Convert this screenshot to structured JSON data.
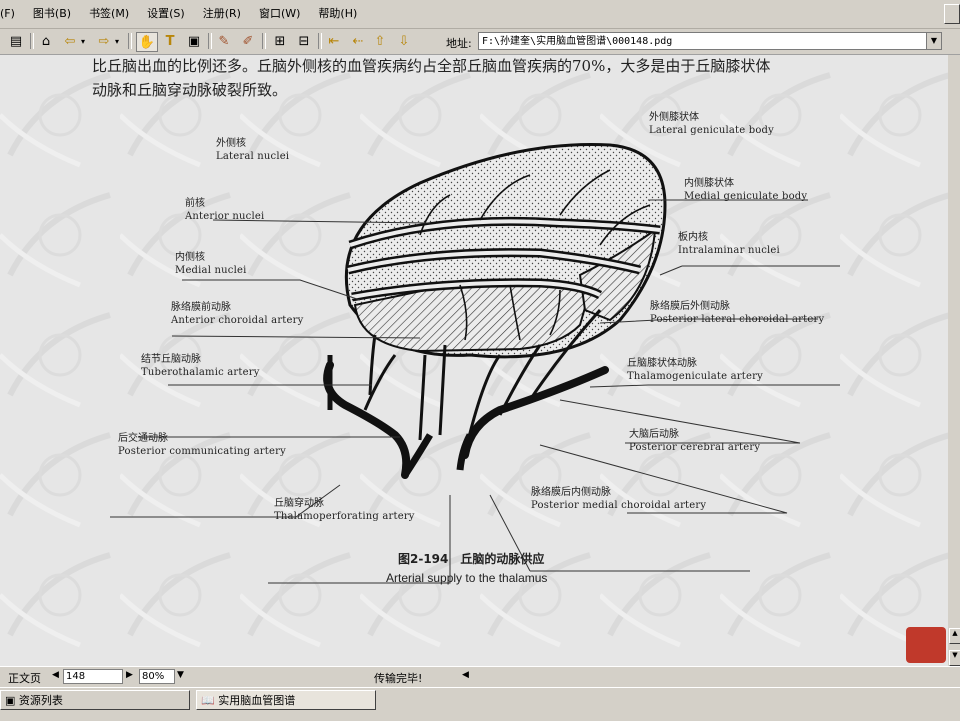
{
  "menu": [
    "(F)",
    "图书(B)",
    "书签(M)",
    "设置(S)",
    "注册(R)",
    "窗口(W)",
    "帮助(H)"
  ],
  "address": {
    "label": "地址:",
    "value": "F:\\孙建奎\\实用脑血管图谱\\000148.pdg"
  },
  "page": {
    "line1": "比丘脑出血的比例还多。丘脑外侧核的血管疾病约占全部丘脑血管疾病的70%，大多是由于丘脑膝状体",
    "line2": "动脉和丘脑穿动脉破裂所致。",
    "labels": {
      "lateral_nuclei": {
        "zh": "外侧核",
        "en": "Lateral nuclei"
      },
      "anterior_nuclei": {
        "zh": "前核",
        "en": "Anterior nuclei"
      },
      "medial_nuclei": {
        "zh": "内侧核",
        "en": "Medial nuclei"
      },
      "anterior_choroidal": {
        "zh": "脉络膜前动脉",
        "en": "Anterior choroidal artery"
      },
      "tuberothalamic": {
        "zh": "结节丘脑动脉",
        "en": "Tuberothalamic artery"
      },
      "posterior_communicating": {
        "zh": "后交通动脉",
        "en": "Posterior communicating artery"
      },
      "thalamoperforating": {
        "zh": "丘脑穿动脉",
        "en": "Thalamoperforating artery"
      },
      "lateral_geniculate": {
        "zh": "外侧膝状体",
        "en": "Lateral geniculate body"
      },
      "medial_geniculate": {
        "zh": "内侧膝状体",
        "en": "Medial geniculate body"
      },
      "intralaminar": {
        "zh": "板内核",
        "en": "Intralaminar nuclei"
      },
      "posterior_lateral_choroidal": {
        "zh": "脉络膜后外侧动脉",
        "en": "Posterior lateral choroidal artery"
      },
      "thalamogeniculate": {
        "zh": "丘脑膝状体动脉",
        "en": "Thalamogeniculate artery"
      },
      "posterior_cerebral": {
        "zh": "大脑后动脉",
        "en": "Posterior cerebral artery"
      },
      "posterior_medial_choroidal": {
        "zh": "脉络膜后内侧动脉",
        "en": "Posterior medial choroidal artery"
      }
    },
    "caption_zh": "图2-194　丘脑的动脉供应",
    "caption_en": "Arterial supply to the thalamus"
  },
  "status": {
    "view": "正文页",
    "page_num": "148",
    "zoom": "80%",
    "message": "传输完毕!"
  },
  "taskbar": {
    "resource_list": "资源列表",
    "book": "实用脑血管图谱"
  }
}
